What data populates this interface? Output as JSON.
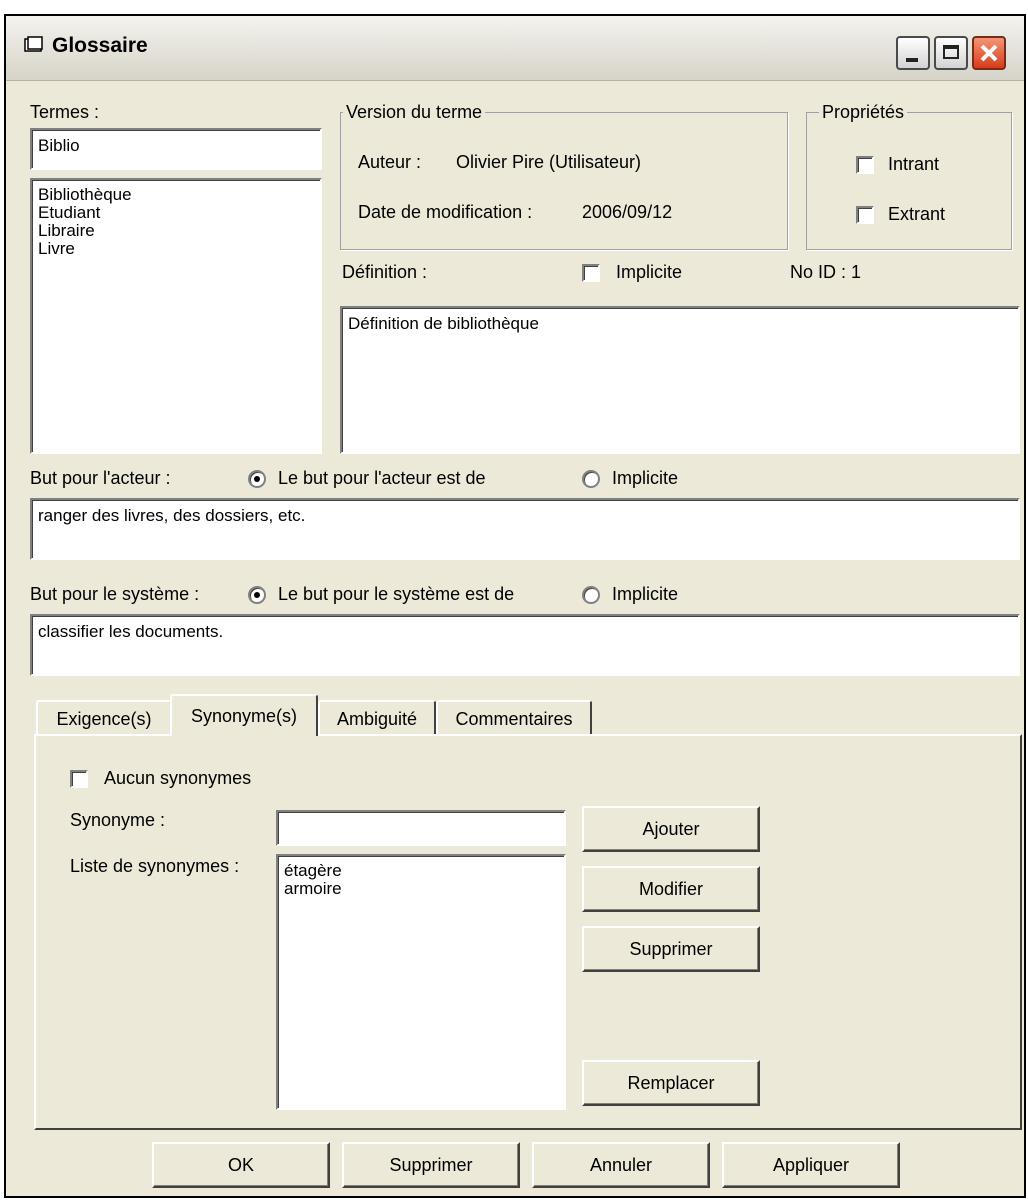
{
  "window": {
    "title": "Glossaire"
  },
  "termes": {
    "label": "Termes :",
    "search_value": "Biblio",
    "items": [
      "Bibliothèque",
      "Etudiant",
      "Libraire",
      "Livre"
    ]
  },
  "version": {
    "legend": "Version du terme",
    "auteur_label": "Auteur :",
    "auteur_value": "Olivier Pire (Utilisateur)",
    "date_label": "Date de modification :",
    "date_value": "2006/09/12"
  },
  "proprietes": {
    "legend": "Propriétés",
    "intrant": "Intrant",
    "extrant": "Extrant"
  },
  "definition": {
    "label": "Définition :",
    "implicite": "Implicite",
    "noid": "No ID :  1",
    "value": "Définition de bibliothèque"
  },
  "but_acteur": {
    "label": "But pour l'acteur :",
    "option1": "Le but pour l'acteur est de",
    "option2": "Implicite",
    "value": "ranger des livres, des dossiers, etc."
  },
  "but_systeme": {
    "label": "But pour le système :",
    "option1": "Le but pour le système est de",
    "option2": "Implicite",
    "value": "classifier les documents."
  },
  "tabs": [
    "Exigence(s)",
    "Synonyme(s)",
    "Ambiguité",
    "Commentaires"
  ],
  "synonymes": {
    "aucun": "Aucun synonymes",
    "synonyme_label": "Synonyme :",
    "synonyme_value": "",
    "liste_label": "Liste de synonymes :",
    "items": [
      "étagère",
      "armoire"
    ],
    "ajouter": "Ajouter",
    "modifier": "Modifier",
    "supprimer": "Supprimer",
    "remplacer": "Remplacer"
  },
  "footer": {
    "ok": "OK",
    "supprimer": "Supprimer",
    "annuler": "Annuler",
    "appliquer": "Appliquer"
  }
}
